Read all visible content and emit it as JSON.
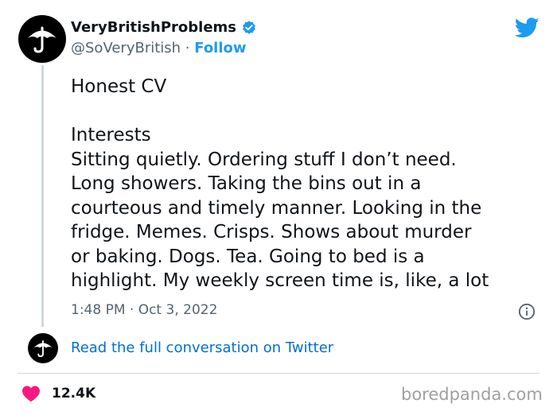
{
  "author": {
    "display_name": "VeryBritishProblems",
    "handle": "@SoVeryBritish",
    "separator": " · ",
    "follow_label": "Follow"
  },
  "icons": {
    "avatar": "umbrella-icon",
    "verified": "verified-badge-icon",
    "brand": "twitter-bird-icon",
    "info": "info-icon",
    "like": "heart-icon"
  },
  "colors": {
    "accent": "#1d9bf0",
    "link": "#006fd6",
    "heart": "#f91880",
    "text": "#0f1419",
    "secondary": "#536471"
  },
  "tweet": {
    "title": "Honest CV",
    "section": "Interests",
    "lines": [
      "Sitting quietly. Ordering stuff I don’t need.",
      "Long showers. Taking the bins out in a",
      "courteous and timely manner. Looking in the",
      "fridge. Memes. Crisps. Shows about murder",
      "or baking. Dogs. Tea. Going to bed is a",
      "highlight. My weekly screen time is, like, a lot"
    ],
    "timestamp": "1:48 PM · Oct 3, 2022"
  },
  "conversation_link": "Read the full conversation on Twitter",
  "engagement": {
    "likes": "12.4K"
  },
  "watermark": "boredpanda.com"
}
